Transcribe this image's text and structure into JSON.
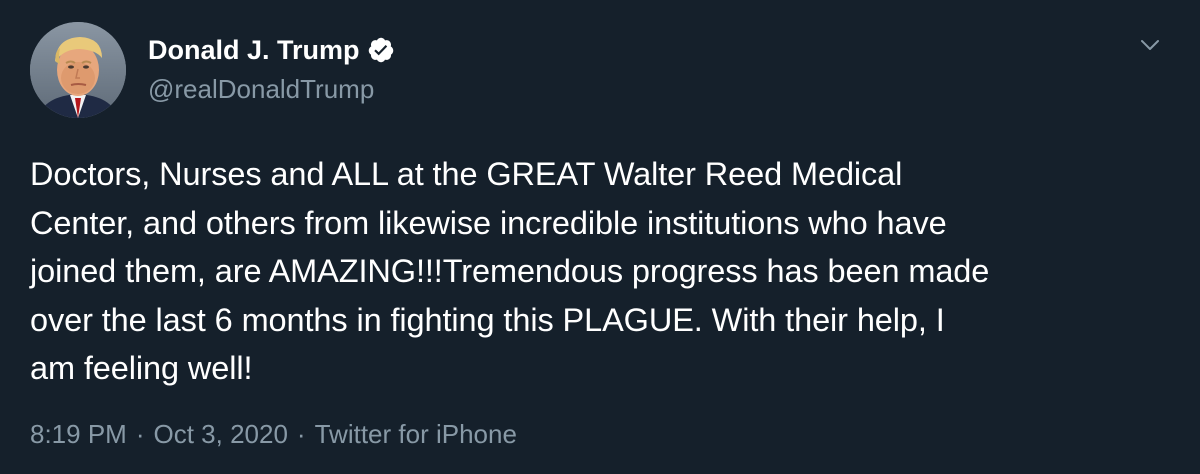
{
  "tweet": {
    "author": {
      "display_name": "Donald J. Trump",
      "handle": "@realDonaldTrump",
      "verified": true,
      "avatar_icon": "profile-photo"
    },
    "lines": [
      "Doctors, Nurses and ALL at the GREAT Walter Reed Medical",
      "Center, and others from likewise incredible institutions who have",
      "joined them, are AMAZING!!!Tremendous progress has been made",
      "over the last 6 months in fighting this PLAGUE. With their help, I",
      "am feeling well!"
    ],
    "meta": {
      "time": "8:19 PM",
      "separator": "·",
      "date": "Oct 3, 2020",
      "source": "Twitter for iPhone"
    },
    "menu_icon": "chevron-down-icon"
  },
  "colors": {
    "background": "#15202b",
    "text": "#ffffff",
    "secondary_text": "#8899a6",
    "verified_badge": "#ffffff"
  }
}
